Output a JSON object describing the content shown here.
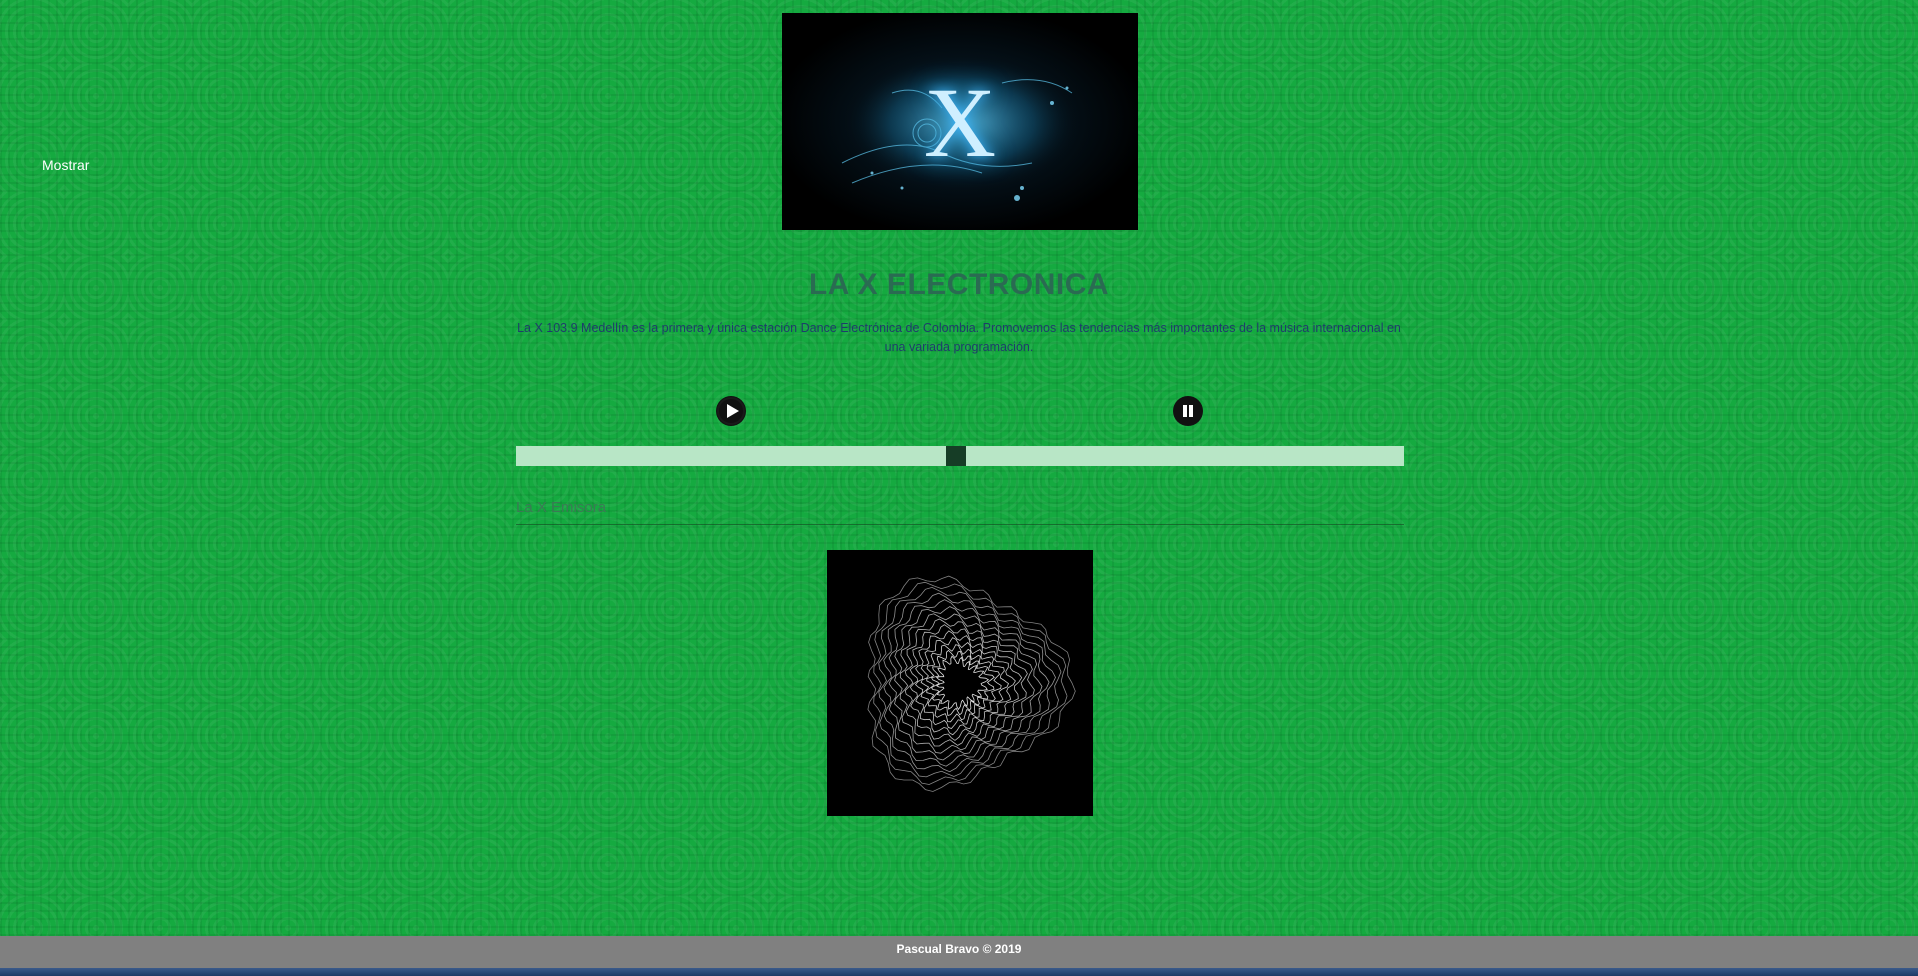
{
  "nav": {
    "show_label": "Mostrar"
  },
  "header": {
    "logo_letter": "X"
  },
  "main": {
    "title": "LA X ELECTRONICA",
    "description": "La X 103.9 Medellín es la primera y única estación Dance Electrónica de Colombia. Promovemos las tendencias más importantes de la música internacional en una variada programación.",
    "station_name": "La X Emisora"
  },
  "player": {
    "play_icon": "play-icon",
    "pause_icon": "pause-icon",
    "progress_fraction": 0.495
  },
  "footer": {
    "text": "Pascual Bravo © 2019"
  },
  "colors": {
    "background": "#15aa40",
    "title": "#2a6b52",
    "description": "#1f3d6b",
    "slider_track": "#b8e6c6",
    "slider_thumb": "#163d26",
    "footer": "#808080"
  }
}
